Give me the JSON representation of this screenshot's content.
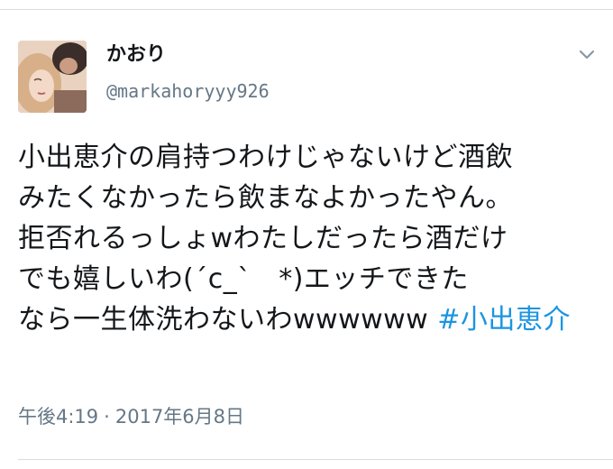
{
  "tweet": {
    "display_name": "かおり",
    "handle": "@markahoryyy926",
    "lines": [
      "小出恵介の肩持つわけじゃないけど酒飲",
      "みたくなかったら飲まなよかったやん。",
      "拒否れるっしょwわたしだったら酒だけ",
      "でも嬉しいわ(´c_`　*)エッチできた"
    ],
    "last_line_text": "なら一生体洗わないわwwwwww ",
    "hashtag": "#小出恵介",
    "time": "午後4:19",
    "separator": "·",
    "date": "2017年6月8日"
  },
  "colors": {
    "text": "#14171a",
    "secondary": "#657786",
    "link": "#1b95e0",
    "divider": "#d8dde2"
  },
  "icons": {
    "avatar": "user-avatar-photo",
    "menu": "chevron-down-icon"
  }
}
